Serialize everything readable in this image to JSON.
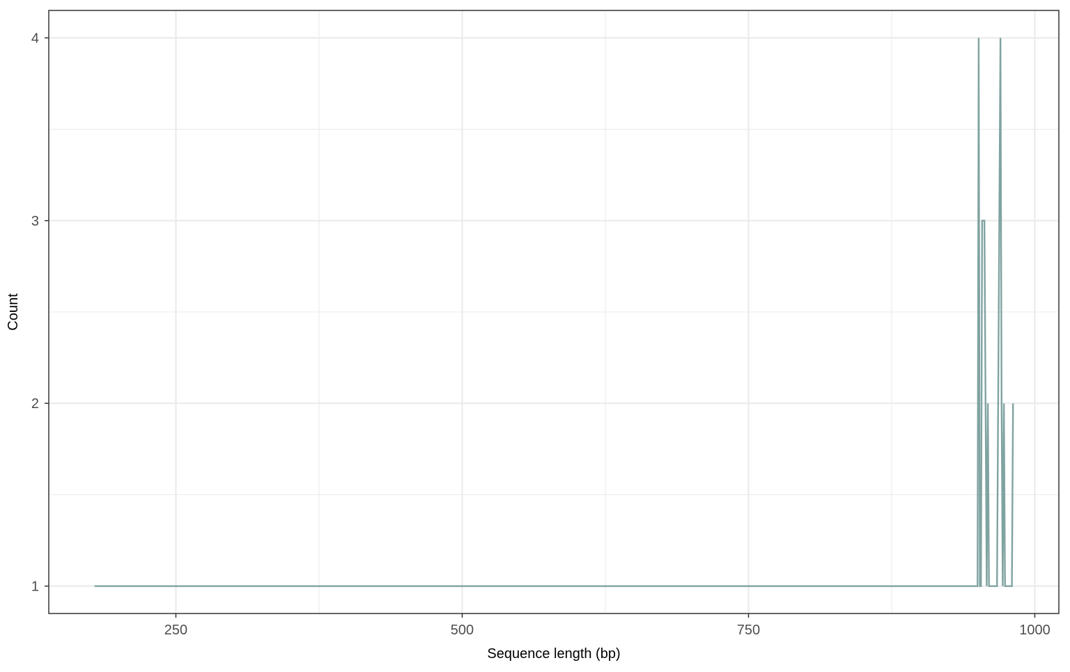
{
  "chart_data": {
    "type": "line",
    "title": "",
    "xlabel": "Sequence length (bp)",
    "ylabel": "Count",
    "xlim": [
      139,
      1021
    ],
    "ylim": [
      0.85,
      4.15
    ],
    "x_ticks": [
      250,
      500,
      750,
      1000
    ],
    "x_tick_labels": [
      "250",
      "500",
      "750",
      "1000"
    ],
    "x_minor_ticks": [
      375,
      625,
      875
    ],
    "y_ticks": [
      1,
      2,
      3,
      4
    ],
    "y_tick_labels": [
      "1",
      "2",
      "3",
      "4"
    ],
    "y_minor_ticks": [
      1.5,
      2.5,
      3.5
    ],
    "grid": true,
    "legend": "none",
    "line_color": "#7fa3a1",
    "series": [
      {
        "x": [
          179,
          950,
          951,
          952,
          953,
          954,
          955,
          956,
          957,
          958,
          959,
          960,
          961,
          962,
          963,
          964,
          965,
          966,
          967,
          968,
          969,
          970,
          971,
          972,
          973,
          974,
          975,
          976,
          977,
          978,
          979,
          980,
          981
        ],
        "y": [
          1,
          1,
          4,
          1,
          1,
          3,
          3,
          3,
          2,
          1,
          2,
          1,
          1,
          1,
          1,
          1,
          1,
          1,
          1,
          2,
          3,
          4,
          2,
          1,
          2,
          1,
          1,
          1,
          1,
          1,
          1,
          1,
          2
        ]
      }
    ]
  }
}
